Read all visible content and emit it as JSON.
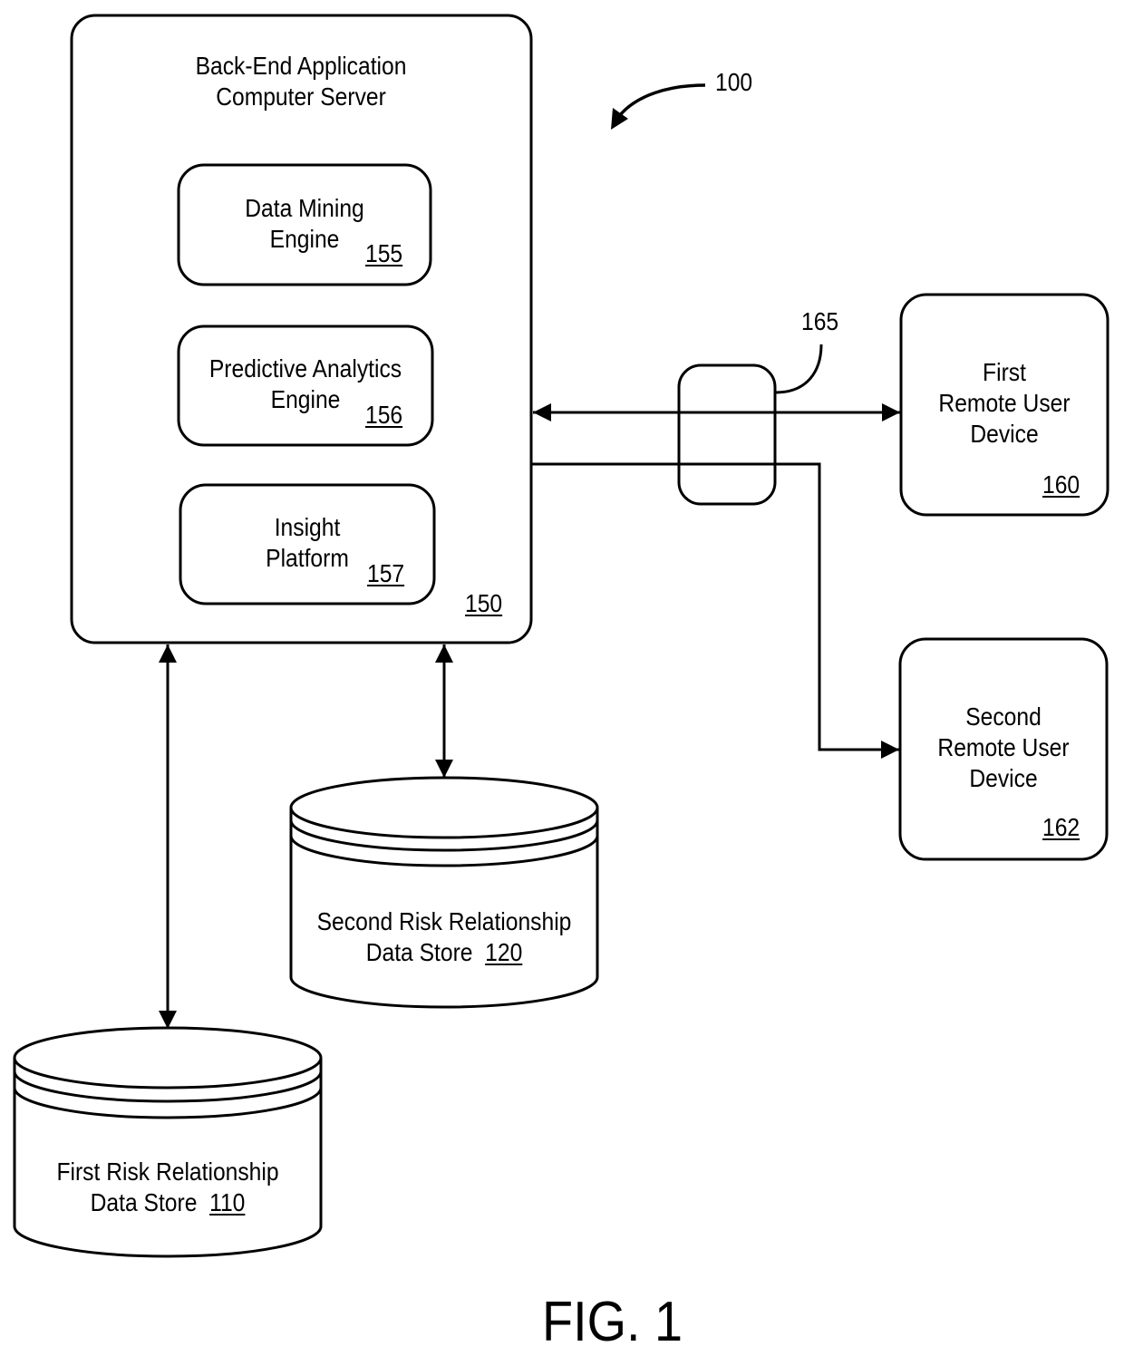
{
  "figure": {
    "caption": "FIG. 1",
    "system_ref": "100"
  },
  "server": {
    "title_line1": "Back-End Application",
    "title_line2": "Computer Server",
    "ref": "150",
    "modules": [
      {
        "line1": "Data Mining",
        "line2": "Engine",
        "ref": "155"
      },
      {
        "line1": "Predictive Analytics",
        "line2": "Engine",
        "ref": "156"
      },
      {
        "line1": "Insight",
        "line2": "Platform",
        "ref": "157"
      }
    ]
  },
  "network": {
    "ref": "165"
  },
  "devices": [
    {
      "line1": "First",
      "line2": "Remote User",
      "line3": "Device",
      "ref": "160"
    },
    {
      "line1": "Second",
      "line2": "Remote User",
      "line3": "Device",
      "ref": "162"
    }
  ],
  "data_stores": [
    {
      "line1": "First Risk Relationship",
      "line2": "Data Store",
      "ref": "110"
    },
    {
      "line1": "Second Risk Relationship",
      "line2": "Data Store",
      "ref": "120"
    }
  ]
}
